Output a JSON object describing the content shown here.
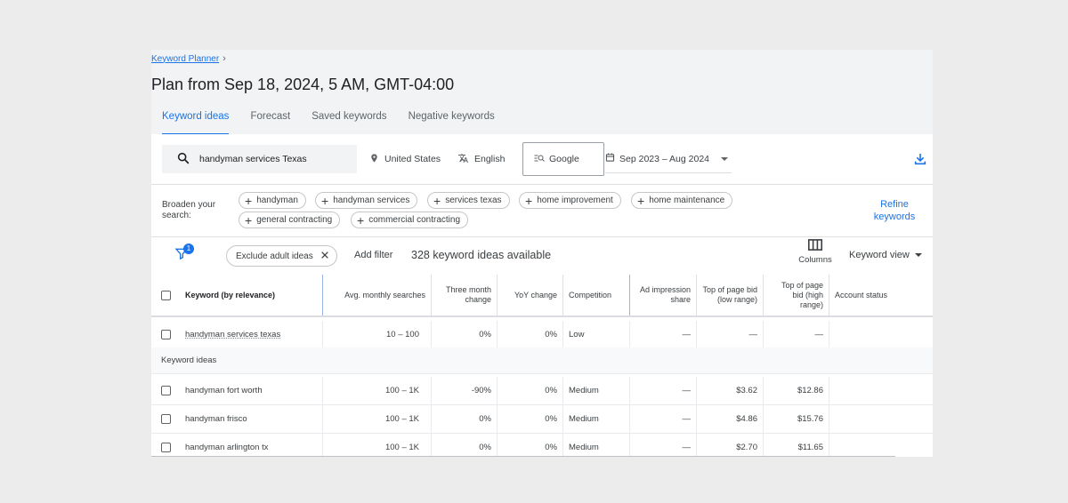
{
  "breadcrumb": {
    "label": "Keyword Planner",
    "chevron": "›"
  },
  "title": "Plan from Sep 18, 2024, 5 AM, GMT-04:00",
  "tabs": [
    {
      "label": "Keyword ideas",
      "active": true
    },
    {
      "label": "Forecast",
      "active": false
    },
    {
      "label": "Saved keywords",
      "active": false
    },
    {
      "label": "Negative keywords",
      "active": false
    }
  ],
  "search": {
    "value": "handyman services Texas",
    "icon": "search-icon"
  },
  "location": {
    "label": "United States",
    "icon": "location-pin-icon"
  },
  "language": {
    "label": "English",
    "icon": "translate-icon"
  },
  "network": {
    "label": "Google",
    "icon": "search-network-icon"
  },
  "date_range": {
    "label": "Sep 2023 – Aug 2024",
    "icon": "calendar-icon"
  },
  "download_icon": "download-icon",
  "broaden": {
    "label": "Broaden your search:",
    "chips": [
      "handyman",
      "handyman services",
      "services texas",
      "home improvement",
      "home maintenance",
      "general contracting",
      "commercial contracting"
    ]
  },
  "refine": {
    "label": "Refine keywords"
  },
  "filters": {
    "badge": "1",
    "exclude_chip": "Exclude adult ideas",
    "add_filter": "Add filter",
    "ideas_count": "328 keyword ideas available",
    "columns_label": "Columns",
    "view_label": "Keyword view"
  },
  "table": {
    "headers": {
      "keyword": "Keyword (by relevance)",
      "avg": "Avg. monthly searches",
      "three_month": "Three month change",
      "yoy": "YoY change",
      "competition": "Competition",
      "ad_share": "Ad impression share",
      "bid_low": "Top of page bid (low range)",
      "bid_high": "Top of page bid (high range)",
      "status": "Account status"
    },
    "provided": [
      {
        "keyword": "handyman services texas",
        "avg": "10 – 100",
        "three_month": "0%",
        "yoy": "0%",
        "competition": "Low",
        "ad_share": "—",
        "bid_low": "—",
        "bid_high": "—",
        "status": ""
      }
    ],
    "section_label": "Keyword ideas",
    "rows": [
      {
        "keyword": "handyman fort worth",
        "avg": "100 – 1K",
        "three_month": "-90%",
        "yoy": "0%",
        "competition": "Medium",
        "ad_share": "—",
        "bid_low": "$3.62",
        "bid_high": "$12.86",
        "status": ""
      },
      {
        "keyword": "handyman frisco",
        "avg": "100 – 1K",
        "three_month": "0%",
        "yoy": "0%",
        "competition": "Medium",
        "ad_share": "—",
        "bid_low": "$4.86",
        "bid_high": "$15.76",
        "status": ""
      },
      {
        "keyword": "handyman arlington tx",
        "avg": "100 – 1K",
        "three_month": "0%",
        "yoy": "0%",
        "competition": "Medium",
        "ad_share": "—",
        "bid_low": "$2.70",
        "bid_high": "$11.65",
        "status": ""
      }
    ]
  },
  "colors": {
    "accent": "#1a73e8",
    "panel": "#f1f3f4",
    "page": "#ececec"
  }
}
